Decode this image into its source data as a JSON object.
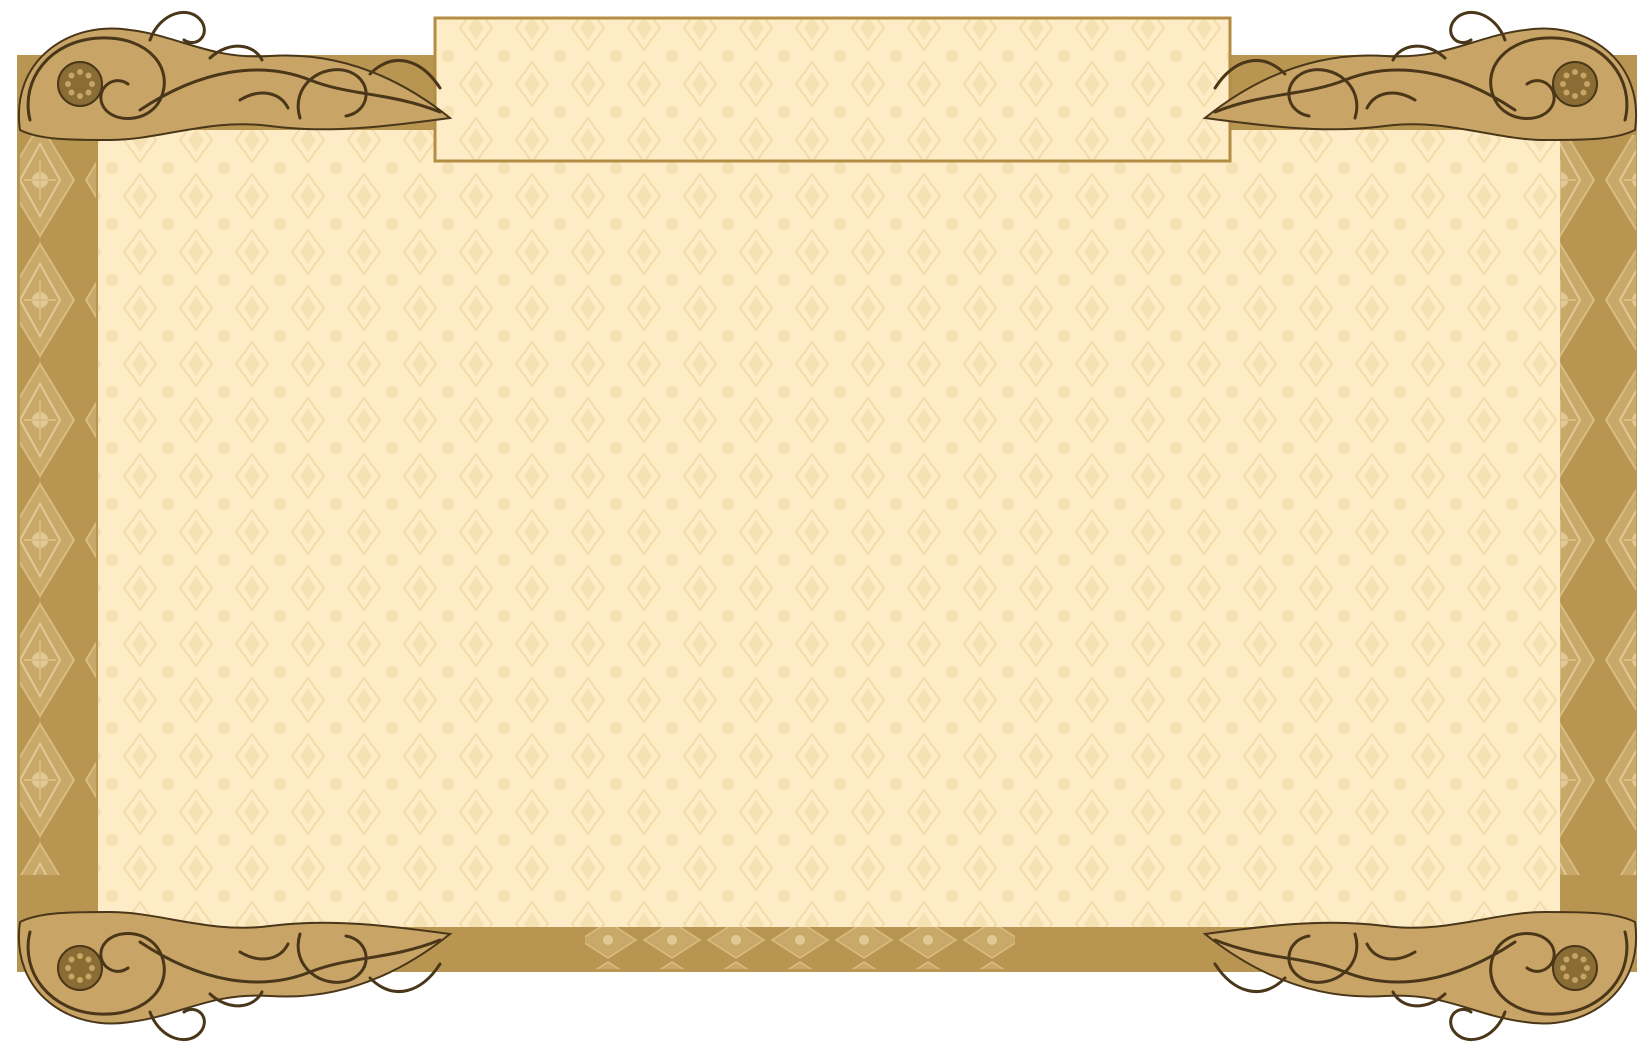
{
  "frame": {
    "title_text": "",
    "body_text": "",
    "colors": {
      "outer_frame": "#b89550",
      "frame_dark": "#8a6d34",
      "ornament_fill": "#c8a566",
      "ornament_line": "#4a3618",
      "paper": "#fdecc6",
      "paper_pattern": "#f3dcaa",
      "side_pattern": "#d9bc82",
      "title_plate_border": "#b48d45"
    }
  }
}
